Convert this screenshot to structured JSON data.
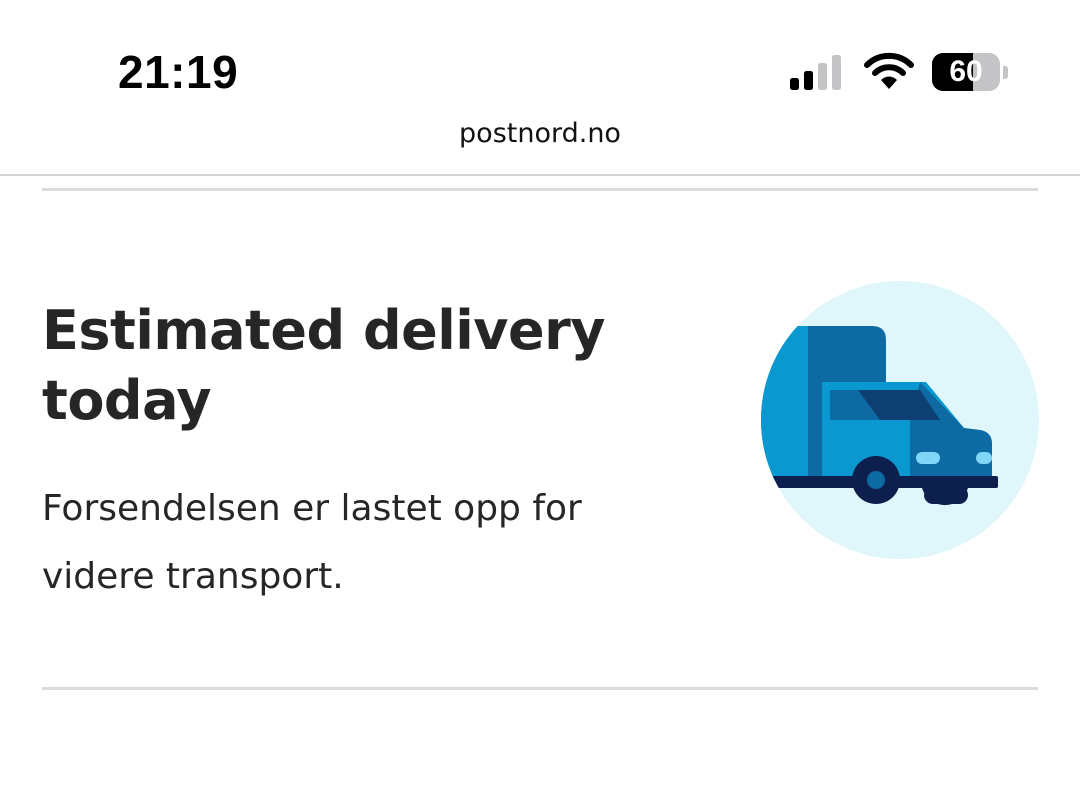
{
  "status_bar": {
    "time": "21:19",
    "battery_level": "60",
    "signal_icon": "cellular-signal-icon",
    "wifi_icon": "wifi-icon",
    "battery_icon": "battery-icon"
  },
  "browser": {
    "url": "postnord.no"
  },
  "delivery": {
    "title_line1": "Estimated delivery",
    "title_line2": "today",
    "status_line1": "Forsendelsen er lastet opp for",
    "status_line2": "videre transport.",
    "illustration_icon": "delivery-truck-icon"
  },
  "colors": {
    "circle_bg": "#dff6fb",
    "truck_dark_blue": "#0e6aa2",
    "truck_light_blue": "#0a98d1",
    "wheel_navy": "#0d1f4c"
  }
}
